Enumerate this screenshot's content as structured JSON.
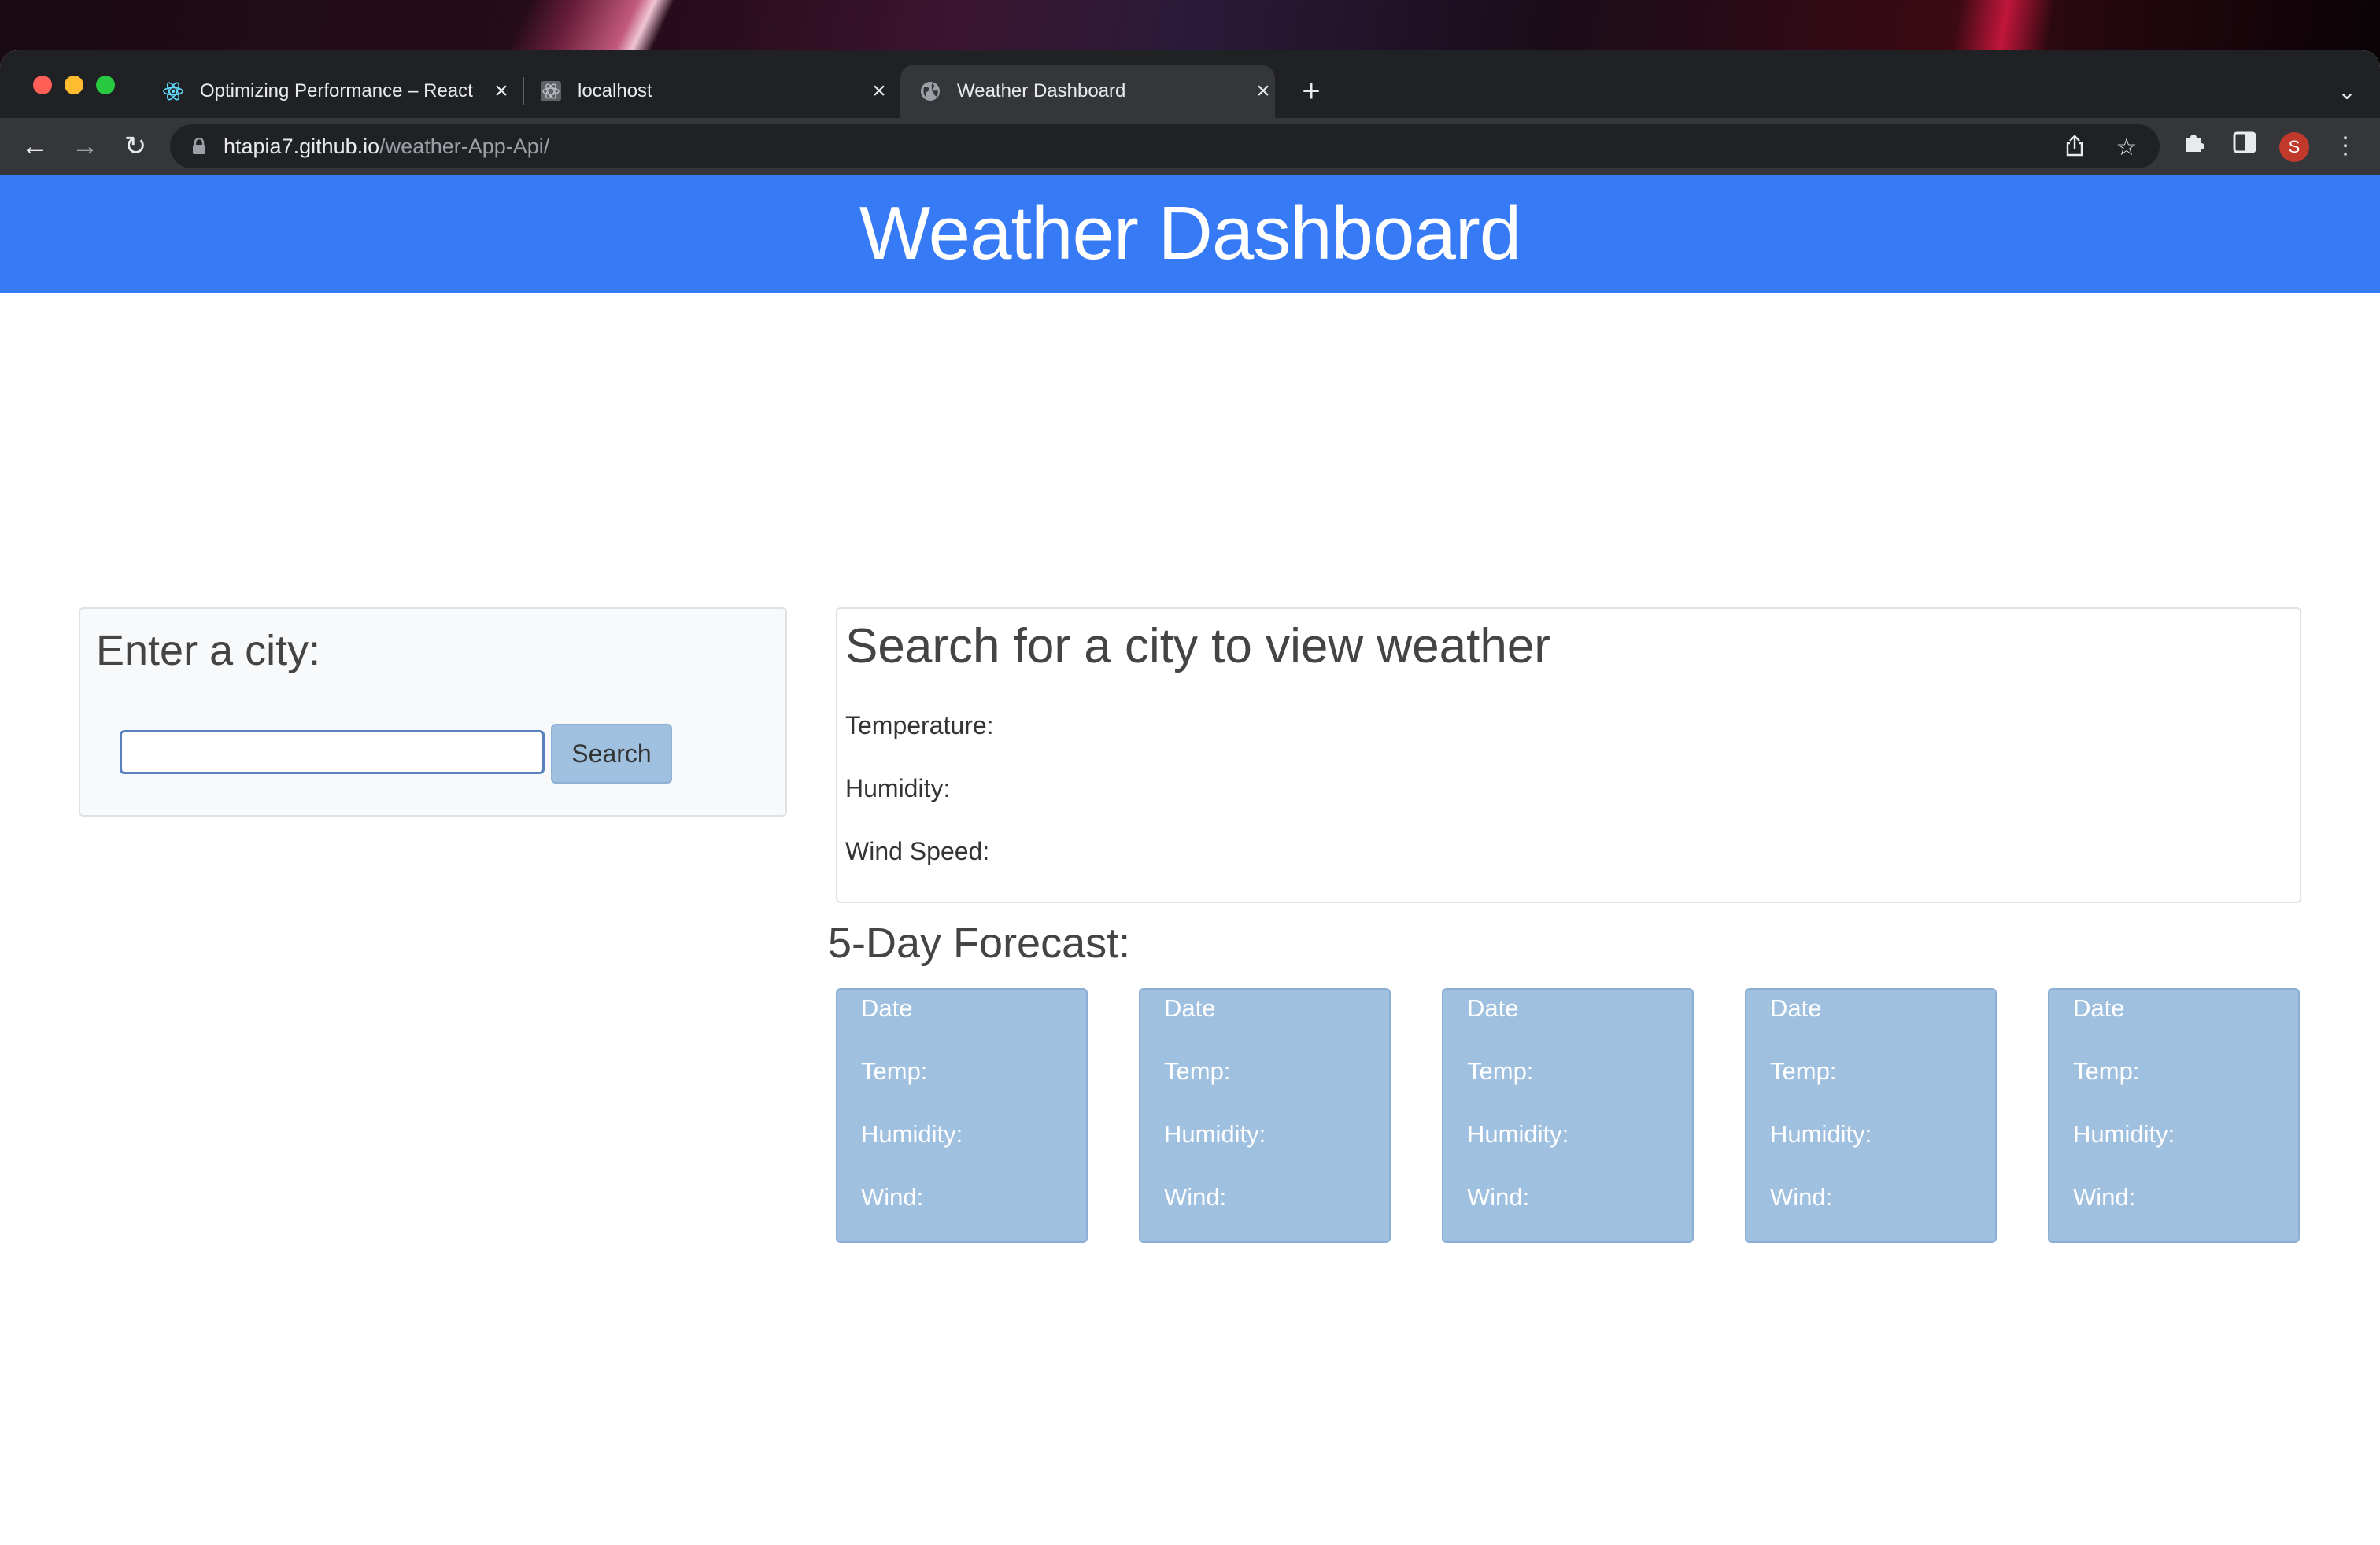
{
  "browser": {
    "tabs": [
      {
        "title": "Optimizing Performance – React",
        "active": false,
        "favicon": "react-icon"
      },
      {
        "title": "localhost",
        "active": false,
        "favicon": "react-icon"
      },
      {
        "title": "Weather Dashboard",
        "active": true,
        "favicon": "globe-icon"
      }
    ],
    "url_host": "htapia7.github.io",
    "url_path": "/weather-App-Api/",
    "profile_initial": "S"
  },
  "page": {
    "header_title": "Weather Dashboard",
    "search": {
      "heading": "Enter a city:",
      "input_value": "",
      "input_placeholder": "",
      "button_label": "Search"
    },
    "current": {
      "heading": "Search for a city to view weather",
      "temperature_label": "Temperature:",
      "humidity_label": "Humidity:",
      "wind_label": "Wind Speed:"
    },
    "forecast": {
      "heading": "5-Day Forecast:",
      "days": [
        {
          "date": "Date",
          "temp": "Temp:",
          "humidity": "Humidity:",
          "wind": "Wind:"
        },
        {
          "date": "Date",
          "temp": "Temp:",
          "humidity": "Humidity:",
          "wind": "Wind:"
        },
        {
          "date": "Date",
          "temp": "Temp:",
          "humidity": "Humidity:",
          "wind": "Wind:"
        },
        {
          "date": "Date",
          "temp": "Temp:",
          "humidity": "Humidity:",
          "wind": "Wind:"
        },
        {
          "date": "Date",
          "temp": "Temp:",
          "humidity": "Humidity:",
          "wind": "Wind:"
        }
      ]
    }
  },
  "colors": {
    "header_blue": "#367bf5",
    "card_blue": "#a0c0e0",
    "text_dark": "#444444"
  }
}
